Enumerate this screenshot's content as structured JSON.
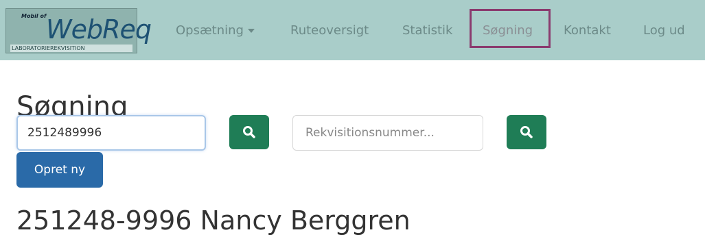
{
  "logo": {
    "small": "Mobil of",
    "big": "WebReq",
    "sub": "LABORATORIEREKVISITION"
  },
  "nav": {
    "items": [
      {
        "label": "Opsætning",
        "has_caret": true
      },
      {
        "label": "Ruteoversigt"
      },
      {
        "label": "Statistik"
      },
      {
        "label": "Søgning",
        "active": true
      },
      {
        "label": "Kontakt"
      },
      {
        "label": "Log ud"
      }
    ]
  },
  "page": {
    "title": "Søgning"
  },
  "search": {
    "cpr_value": "2512489996",
    "requisition_placeholder": "Rekvisitionsnummer..."
  },
  "buttons": {
    "create": "Opret ny"
  },
  "patient": {
    "header": "251248-9996 Nancy Berggren"
  },
  "colors": {
    "navbar": "#a9cdc9",
    "search_button": "#1f7d56",
    "create_button": "#2a6aa8",
    "highlight": "#8a3a6e"
  }
}
